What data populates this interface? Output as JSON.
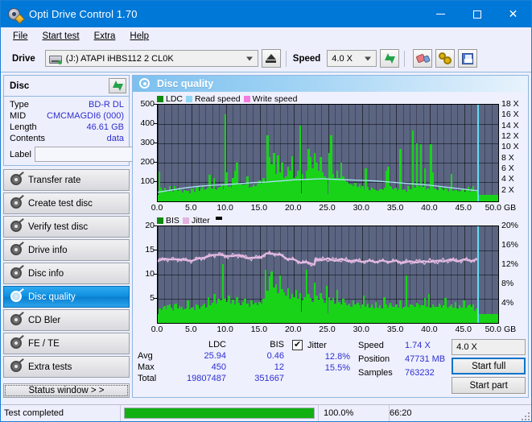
{
  "window": {
    "title": "Opti Drive Control 1.70",
    "icon": "disc-pen-icon",
    "minimize": "–",
    "maximize": "□",
    "close": "✕"
  },
  "menu": {
    "items": [
      {
        "label": "File",
        "name": "menu-file"
      },
      {
        "label": "Start test",
        "name": "menu-start-test"
      },
      {
        "label": "Extra",
        "name": "menu-extra"
      },
      {
        "label": "Help",
        "name": "menu-help"
      }
    ]
  },
  "toolbar": {
    "drive_label": "Drive",
    "drive_value": "(J:)  ATAPI iHBS112  2 CL0K",
    "eject_tooltip": "Eject",
    "speed_label": "Speed",
    "speed_value": "4.0 X",
    "refresh_icon": "green-refresh-arrows-icon",
    "erase_icon": "eraser-icon",
    "settings_icon": "gears-icon",
    "save_icon": "floppy-save-icon"
  },
  "disc_panel": {
    "title": "Disc",
    "refresh_icon": "green-refresh-arrows-icon",
    "rows": [
      {
        "key": "Type",
        "value": "BD-R DL"
      },
      {
        "key": "MID",
        "value": "CMCMAGDI6 (000)"
      },
      {
        "key": "Length",
        "value": "46.61 GB"
      },
      {
        "key": "Contents",
        "value": "data"
      }
    ],
    "label_key": "Label",
    "label_value": "",
    "label_placeholder": "",
    "disc_button_icon": "cd-disc-icon"
  },
  "sidebar": {
    "items": [
      {
        "label": "Transfer rate",
        "name": "sidebar-item-transfer-rate",
        "active": false
      },
      {
        "label": "Create test disc",
        "name": "sidebar-item-create-test-disc",
        "active": false
      },
      {
        "label": "Verify test disc",
        "name": "sidebar-item-verify-test-disc",
        "active": false
      },
      {
        "label": "Drive info",
        "name": "sidebar-item-drive-info",
        "active": false
      },
      {
        "label": "Disc info",
        "name": "sidebar-item-disc-info",
        "active": false
      },
      {
        "label": "Disc quality",
        "name": "sidebar-item-disc-quality",
        "active": true
      },
      {
        "label": "CD Bler",
        "name": "sidebar-item-cd-bler",
        "active": false
      },
      {
        "label": "FE / TE",
        "name": "sidebar-item-fe-te",
        "active": false
      },
      {
        "label": "Extra tests",
        "name": "sidebar-item-extra-tests",
        "active": false
      }
    ],
    "status_window_label": "Status window > >"
  },
  "content": {
    "title": "Disc quality",
    "icon": "disc-quality-icon"
  },
  "stats": {
    "col_headers": [
      "LDC",
      "BIS"
    ],
    "row_labels": [
      "Avg",
      "Max",
      "Total"
    ],
    "ldc": {
      "avg": "25.94",
      "max": "450",
      "total": "19807487"
    },
    "bis": {
      "avg": "0.46",
      "max": "12",
      "total": "351667"
    },
    "jitter": {
      "label": "Jitter",
      "checked": true,
      "avg": "12.8%",
      "max": "15.5%"
    },
    "speed_label": "Speed",
    "speed_value": "1.74 X",
    "position_label": "Position",
    "position_value": "47731 MB",
    "samples_label": "Samples",
    "samples_value": "763232",
    "speed_select_value": "4.0 X",
    "start_full_label": "Start full",
    "start_part_label": "Start part"
  },
  "statusbar": {
    "message": "Test completed",
    "progress_percent_label": "100.0%",
    "progress_value": 100,
    "elapsed": "66:20"
  },
  "chart_data": [
    {
      "type": "bar",
      "name": "ldc-read-speed-chart",
      "title": "",
      "xlabel": "GB",
      "ylabel": "LDC",
      "xlim": [
        0,
        50
      ],
      "ylim": [
        0,
        500
      ],
      "y2lim": [
        0,
        18
      ],
      "grid": true,
      "legend_position": "top-left",
      "legend": [
        {
          "label": "LDC",
          "color": "#0e8a0e"
        },
        {
          "label": "Read speed",
          "color": "#8fd6f2"
        },
        {
          "label": "Write speed",
          "color": "#f47ce0"
        }
      ],
      "xticks": [
        "0.0",
        "5.0",
        "10.0",
        "15.0",
        "20.0",
        "25.0",
        "30.0",
        "35.0",
        "40.0",
        "45.0",
        "50.0 GB"
      ],
      "yticks_left": [
        "100",
        "200",
        "300",
        "400",
        "500"
      ],
      "yticks_right": [
        "2 X",
        "4 X",
        "6 X",
        "8 X",
        "10 X",
        "12 X",
        "14 X",
        "16 X",
        "18 X"
      ],
      "cursor_x": 46.9,
      "series": [
        {
          "name": "LDC",
          "color": "#19d319",
          "kind": "bars",
          "x": [
            0.1,
            0.3,
            0.5,
            0.8,
            1.0,
            1.3,
            1.5,
            1.8,
            2.0,
            2.3,
            2.5,
            2.8,
            3.0,
            3.3,
            3.6,
            3.9,
            4.2,
            4.5,
            4.8,
            5.1,
            5.4,
            5.7,
            6.0,
            6.3,
            6.6,
            6.9,
            7.2,
            7.5,
            7.8,
            8.1,
            8.4,
            8.7,
            9.0,
            9.3,
            9.6,
            9.8,
            10.0,
            10.3,
            10.6,
            10.9,
            11.2,
            11.5,
            11.8,
            12.1,
            12.4,
            12.7,
            13.0,
            13.3,
            13.6,
            13.9,
            14.2,
            14.5,
            14.8,
            15.1,
            15.4,
            15.7,
            16.0,
            16.3,
            16.6,
            16.9,
            17.2,
            17.5,
            17.8,
            18.1,
            18.4,
            18.7,
            19.0,
            19.3,
            19.6,
            19.9,
            20.2,
            20.5,
            20.8,
            21.1,
            21.4,
            21.7,
            22.0,
            22.3,
            22.6,
            22.9,
            23.2,
            23.5,
            23.8,
            24.1,
            24.4,
            24.7,
            25.0,
            25.3,
            25.6,
            25.9,
            26.2,
            26.5,
            26.8,
            27.1,
            27.4,
            27.7,
            28.0,
            28.3,
            28.6,
            28.9,
            29.2,
            29.5,
            29.8,
            30.1,
            30.4,
            30.7,
            31.0,
            31.3,
            31.6,
            31.9,
            32.2,
            32.5,
            32.8,
            33.1,
            33.4,
            33.7,
            34.0,
            34.3,
            34.6,
            34.9,
            35.2,
            35.5,
            35.8,
            36.1,
            36.4,
            36.7,
            37.0,
            37.3,
            37.6,
            37.9,
            38.2,
            38.5,
            38.8,
            39.1,
            39.4,
            39.7,
            40.0,
            40.3,
            40.6,
            40.9,
            41.2,
            41.5,
            41.8,
            42.1,
            42.4,
            42.7,
            43.0,
            43.3,
            43.6,
            43.9,
            44.2,
            44.5,
            44.8,
            45.1,
            45.4,
            45.7,
            46.0,
            46.3,
            46.6,
            46.9
          ],
          "y": [
            155,
            70,
            60,
            55,
            58,
            50,
            46,
            52,
            44,
            48,
            42,
            55,
            40,
            46,
            44,
            50,
            48,
            42,
            46,
            52,
            50,
            46,
            56,
            48,
            60,
            62,
            70,
            138,
            66,
            120,
            60,
            72,
            68,
            88,
            62,
            448,
            150,
            74,
            70,
            120,
            160,
            200,
            86,
            90,
            82,
            88,
            130,
            70,
            76,
            86,
            80,
            90,
            110,
            92,
            120,
            104,
            342,
            230,
            190,
            250,
            140,
            236,
            150,
            200,
            120,
            130,
            180,
            160,
            235,
            120,
            130,
            160,
            392,
            140,
            110,
            160,
            270,
            230,
            170,
            250,
            200,
            160,
            228,
            150,
            130,
            120,
            250,
            340,
            140,
            120,
            160,
            120,
            200,
            130,
            110,
            100,
            92,
            86,
            80,
            96,
            72,
            86,
            66,
            60,
            172,
            64,
            58,
            70,
            62,
            60,
            56,
            54,
            62,
            58,
            160,
            180,
            78,
            64,
            60,
            55,
            62,
            270,
            58,
            62,
            52,
            78,
            62,
            366,
            70,
            300,
            72,
            296,
            65,
            170,
            58,
            64,
            294,
            150,
            62,
            58,
            56,
            60,
            60,
            56,
            54,
            52,
            142,
            56,
            58,
            54,
            52,
            56,
            50,
            52,
            48,
            50,
            48,
            50
          ]
        },
        {
          "name": "Read speed",
          "color": "#a9e2f6",
          "kind": "line",
          "x": [
            0,
            2,
            4,
            6,
            8,
            10,
            12,
            14,
            16,
            18,
            20,
            22,
            24,
            26,
            28,
            30,
            32,
            34,
            36,
            38,
            40,
            42,
            44,
            46,
            46.9
          ],
          "y_right": [
            1.7,
            2.1,
            2.5,
            2.8,
            3.0,
            3.1,
            3.3,
            3.5,
            3.6,
            3.8,
            4.0,
            4.1,
            4.2,
            4.1,
            4.0,
            3.9,
            3.8,
            3.6,
            3.4,
            3.2,
            3.0,
            2.7,
            2.4,
            2.1,
            2.0
          ]
        }
      ]
    },
    {
      "type": "bar",
      "name": "bis-jitter-chart",
      "title": "",
      "xlabel": "GB",
      "ylabel": "BIS",
      "xlim": [
        0,
        50
      ],
      "ylim": [
        0,
        20
      ],
      "y2lim": [
        0,
        20
      ],
      "grid": true,
      "legend_position": "top-left",
      "legend": [
        {
          "label": "BIS",
          "color": "#0e8a0e"
        },
        {
          "label": "Jitter",
          "color": "#e3b4e0"
        }
      ],
      "xticks": [
        "0.0",
        "5.0",
        "10.0",
        "15.0",
        "20.0",
        "25.0",
        "30.0",
        "35.0",
        "40.0",
        "45.0",
        "50.0 GB"
      ],
      "yticks_left": [
        "5",
        "10",
        "15",
        "20"
      ],
      "yticks_right": [
        "4%",
        "8%",
        "12%",
        "16%",
        "20%"
      ],
      "cursor_x": 46.9,
      "series": [
        {
          "name": "BIS",
          "color": "#19d319",
          "kind": "bars",
          "x": [
            0.1,
            0.4,
            0.7,
            1.0,
            1.3,
            1.6,
            1.9,
            2.2,
            2.5,
            2.8,
            3.1,
            3.4,
            3.7,
            4.0,
            4.3,
            4.6,
            4.9,
            5.2,
            5.5,
            5.8,
            6.1,
            6.4,
            6.7,
            7.0,
            7.3,
            7.6,
            7.9,
            8.2,
            8.5,
            8.8,
            9.1,
            9.4,
            9.7,
            10.0,
            10.3,
            10.6,
            10.9,
            11.2,
            11.5,
            11.8,
            12.1,
            12.4,
            12.7,
            13.0,
            13.3,
            13.6,
            13.9,
            14.2,
            14.5,
            14.8,
            15.1,
            15.4,
            15.7,
            16.0,
            16.3,
            16.6,
            16.9,
            17.2,
            17.5,
            17.8,
            18.1,
            18.4,
            18.7,
            19.0,
            19.3,
            19.6,
            19.9,
            20.2,
            20.5,
            20.8,
            21.1,
            21.4,
            21.7,
            22.0,
            22.3,
            22.6,
            22.9,
            23.2,
            23.5,
            23.8,
            24.1,
            24.4,
            24.7,
            25.0,
            25.3,
            25.6,
            25.9,
            26.2,
            26.5,
            26.8,
            27.1,
            27.4,
            27.7,
            28.0,
            28.3,
            28.6,
            28.9,
            29.2,
            29.5,
            29.8,
            30.1,
            30.4,
            30.7,
            31.0,
            31.3,
            31.6,
            31.9,
            32.2,
            32.5,
            32.8,
            33.1,
            33.4,
            33.7,
            34.0,
            34.3,
            34.6,
            34.9,
            35.2,
            35.5,
            35.8,
            36.1,
            36.4,
            36.7,
            37.0,
            37.3,
            37.6,
            37.9,
            38.2,
            38.5,
            38.8,
            39.1,
            39.4,
            39.7,
            40.0,
            40.3,
            40.6,
            40.9,
            41.2,
            41.5,
            41.8,
            42.1,
            42.4,
            42.7,
            43.0,
            43.3,
            43.6,
            43.9,
            44.2,
            44.5,
            44.8,
            45.1,
            45.4,
            45.7,
            46.0,
            46.3,
            46.6,
            46.9
          ],
          "y": [
            3.0,
            2.6,
            3.4,
            2.8,
            3.6,
            3.0,
            2.6,
            2.2,
            4.0,
            3.0,
            2.8,
            3.4,
            2.6,
            3.0,
            4.6,
            2.8,
            3.2,
            2.6,
            3.8,
            3.0,
            2.8,
            3.4,
            4.0,
            3.2,
            5.4,
            3.6,
            4.2,
            6.0,
            4.0,
            5.0,
            4.6,
            12.2,
            5.0,
            4.4,
            5.6,
            4.0,
            4.8,
            3.8,
            5.4,
            4.2,
            3.6,
            4.4,
            5.0,
            4.0,
            3.4,
            4.6,
            3.8,
            4.2,
            3.6,
            4.4,
            4.0,
            5.0,
            11.0,
            6.6,
            9.6,
            10.6,
            7.4,
            8.0,
            6.2,
            9.8,
            7.0,
            6.4,
            5.6,
            7.2,
            5.0,
            6.0,
            5.4,
            6.8,
            5.0,
            6.2,
            4.6,
            5.4,
            11.0,
            6.0,
            5.2,
            4.4,
            8.4,
            5.6,
            4.8,
            6.2,
            5.0,
            4.2,
            7.6,
            5.4,
            4.6,
            5.2,
            4.0,
            6.8,
            4.4,
            3.8,
            5.0,
            4.2,
            3.6,
            4.0,
            3.4,
            4.6,
            3.8,
            4.2,
            3.6,
            3.0,
            5.6,
            3.4,
            4.0,
            3.2,
            3.8,
            3.0,
            4.4,
            3.2,
            3.6,
            3.0,
            5.4,
            3.8,
            3.2,
            4.2,
            3.4,
            3.0,
            3.8,
            3.2,
            4.6,
            3.0,
            3.4,
            9.8,
            3.2,
            3.8,
            3.0,
            3.4,
            4.2,
            3.2,
            3.6,
            3.0,
            5.2,
            3.4,
            6.0,
            3.2,
            3.8,
            3.0,
            3.4,
            4.0,
            3.2,
            3.6,
            5.2,
            3.0,
            3.4,
            3.8,
            3.2,
            4.4,
            3.0,
            3.6,
            3.2,
            4.6,
            3.0,
            3.4,
            3.8,
            3.2
          ]
        },
        {
          "name": "Jitter",
          "color": "#e4b9e2",
          "kind": "line",
          "x": [
            0,
            1,
            2,
            3,
            4,
            5,
            6,
            7,
            8,
            9,
            10,
            11,
            12,
            13,
            14,
            15,
            16,
            17,
            18,
            19,
            20,
            21,
            22,
            23,
            23.2,
            24,
            25,
            26,
            27,
            28,
            29,
            30,
            31,
            32,
            33,
            34,
            35,
            36,
            37,
            38,
            39,
            40,
            41,
            42,
            43,
            44,
            45,
            46,
            46.9
          ],
          "y": [
            12.8,
            13.3,
            13.1,
            13.2,
            13.0,
            12.9,
            13.3,
            13.6,
            14.0,
            14.2,
            13.8,
            13.9,
            14.0,
            13.5,
            13.4,
            13.6,
            14.3,
            14.4,
            14.0,
            13.4,
            13.0,
            12.6,
            12.4,
            12.2,
            13.2,
            13.1,
            13.2,
            13.0,
            13.1,
            12.9,
            12.8,
            12.8,
            12.7,
            12.8,
            12.7,
            12.8,
            12.7,
            12.6,
            12.6,
            12.7,
            12.6,
            12.8,
            12.7,
            12.9,
            13.0,
            12.9,
            13.0,
            13.0,
            13.0
          ]
        }
      ]
    }
  ]
}
